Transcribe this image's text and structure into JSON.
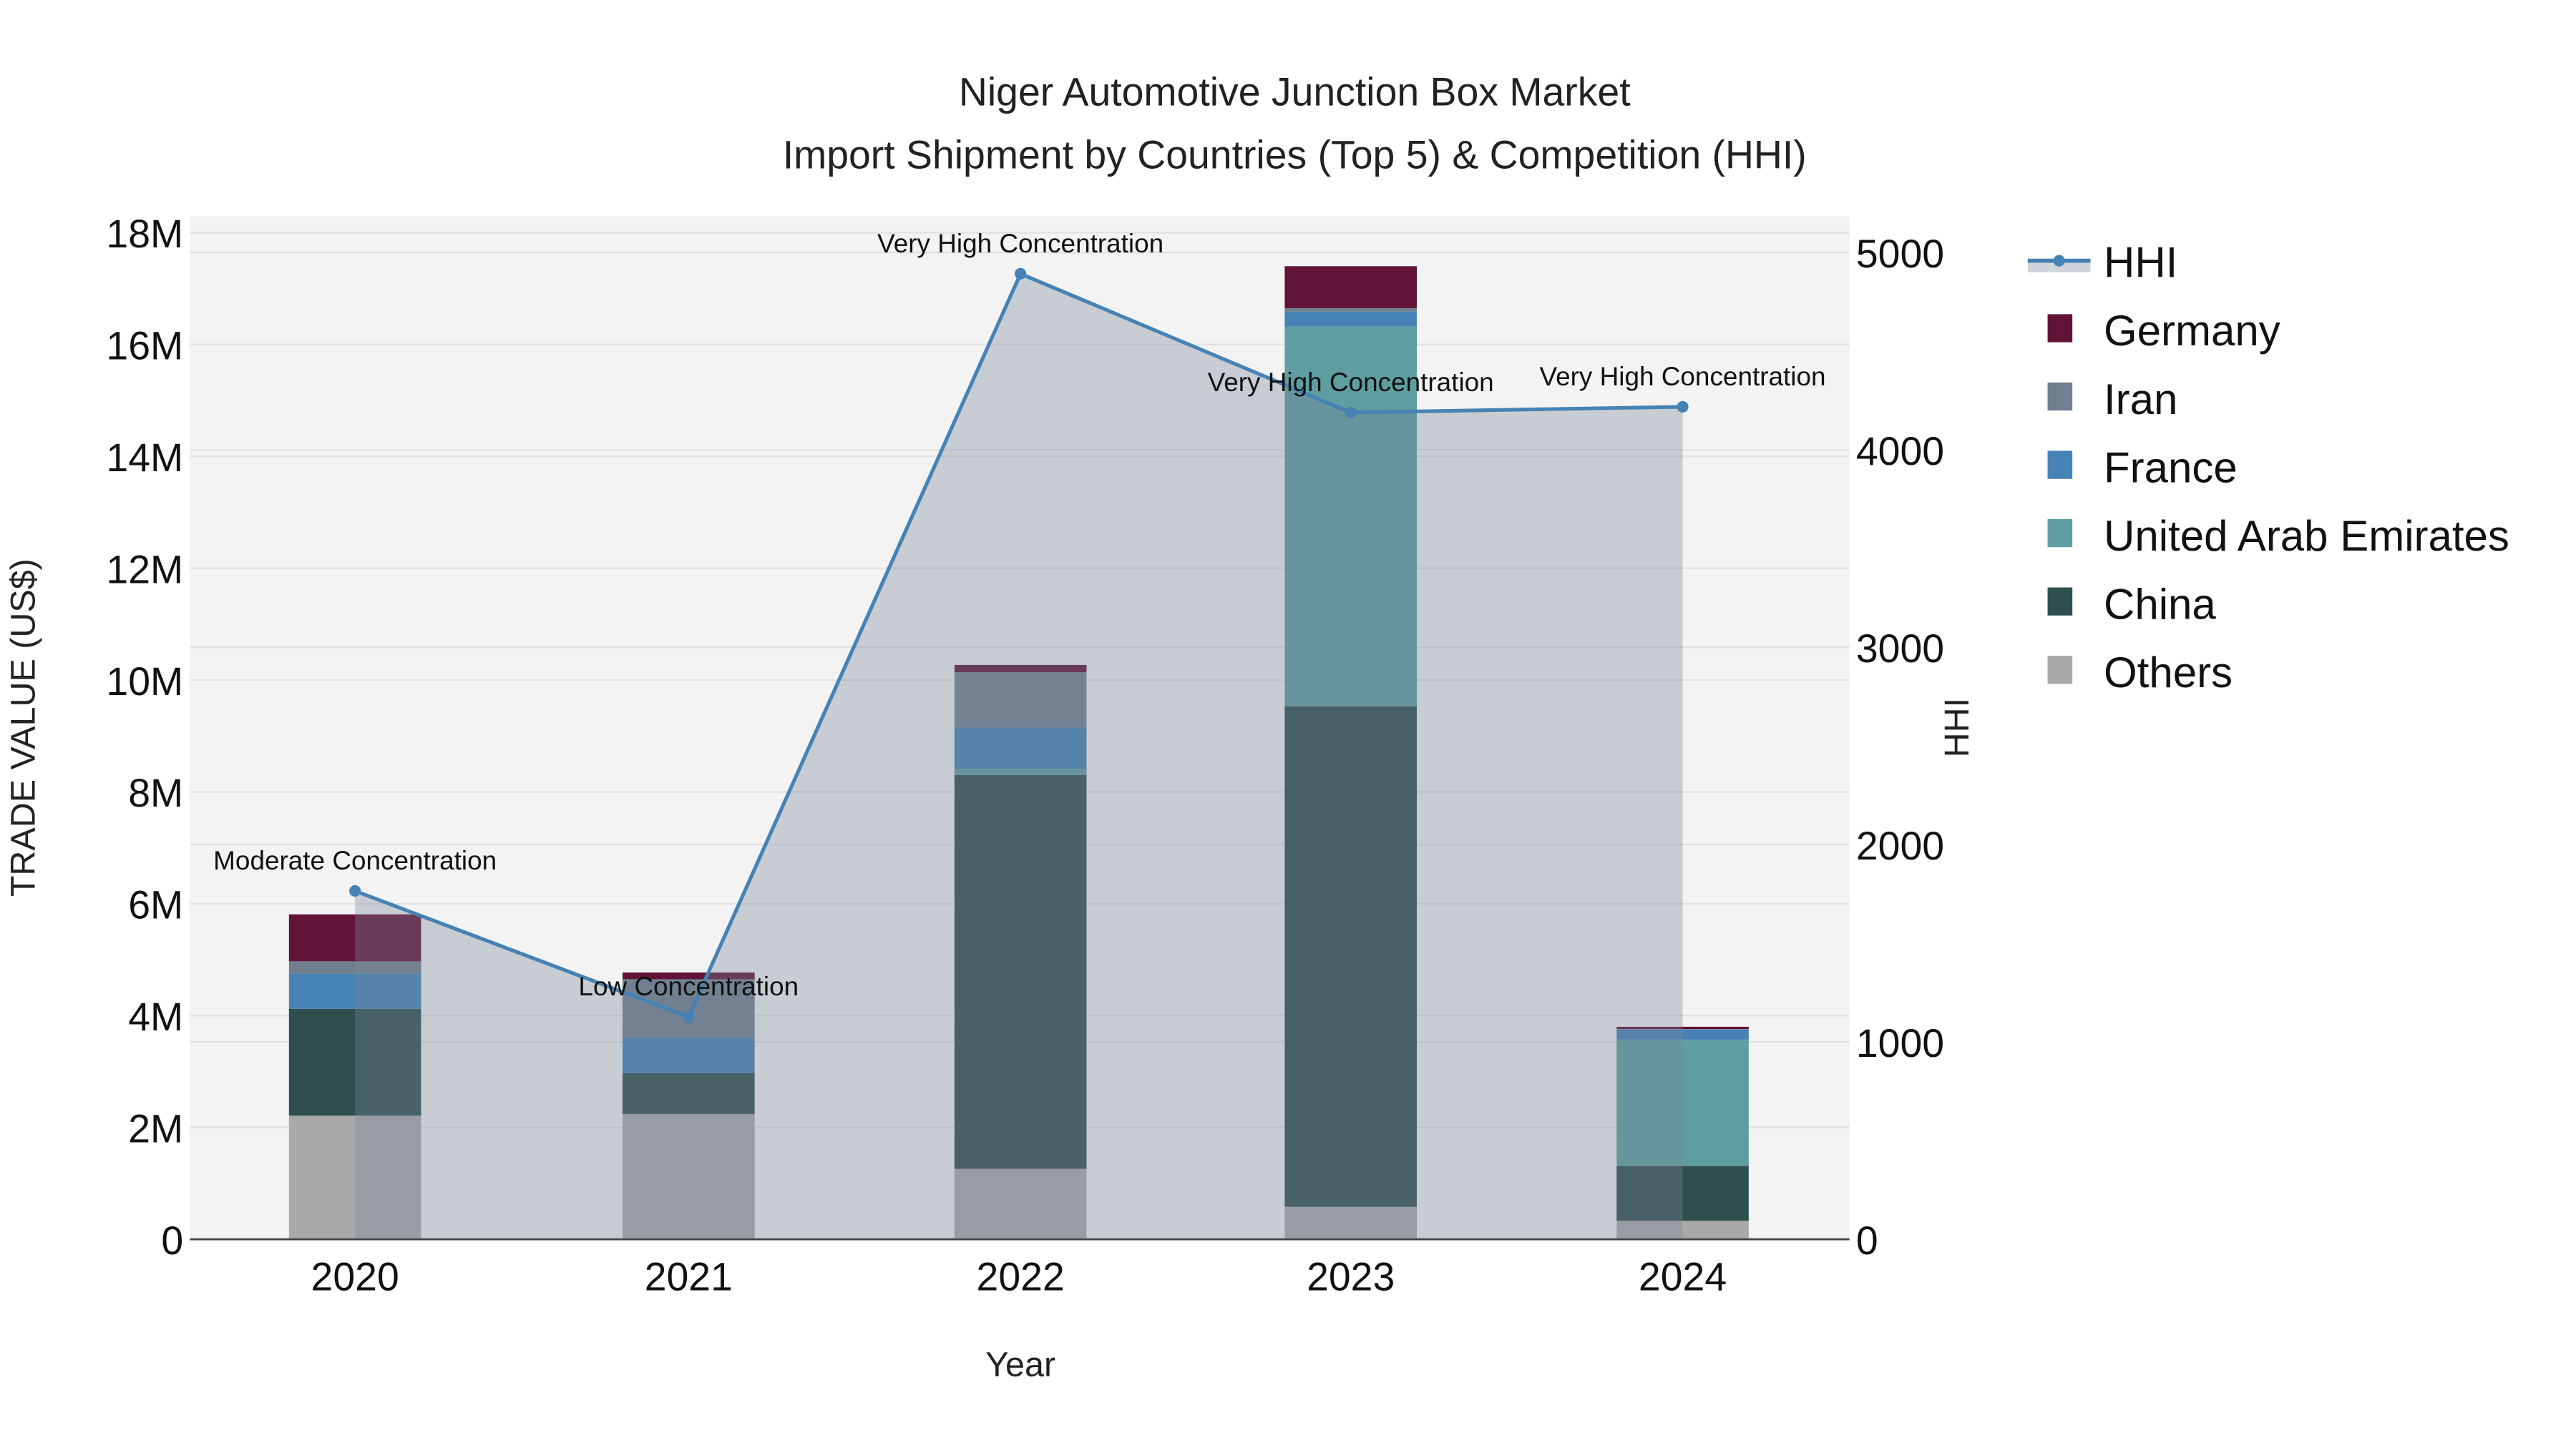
{
  "chart_data": {
    "type": "bar",
    "title": "Niger Automotive Junction Box Market",
    "subtitle": "Import Shipment by Countries (Top 5) & Competition (HHI)",
    "xlabel": "Year",
    "ylabel": "TRADE VALUE (US$)",
    "y2label": "HHI",
    "categories": [
      "2020",
      "2021",
      "2022",
      "2023",
      "2024"
    ],
    "ylim": [
      0,
      18200000
    ],
    "y2lim": [
      0,
      5150
    ],
    "yticks": [
      0,
      2000000,
      4000000,
      6000000,
      8000000,
      10000000,
      12000000,
      14000000,
      16000000,
      18000000
    ],
    "ytick_labels": [
      "0",
      "2M",
      "4M",
      "6M",
      "8M",
      "10M",
      "12M",
      "14M",
      "16M",
      "18M"
    ],
    "y2ticks": [
      0,
      1000,
      2000,
      3000,
      4000,
      5000
    ],
    "y2tick_labels": [
      "0",
      "1000",
      "2000",
      "3000",
      "4000",
      "5000"
    ],
    "stacking": "stacked",
    "series": [
      {
        "name": "Others",
        "color": "#A9A9A9",
        "values": [
          2210000,
          2240000,
          1260000,
          580000,
          330000
        ]
      },
      {
        "name": "China",
        "color": "#2F4F4F",
        "values": [
          1910000,
          730000,
          7040000,
          8950000,
          980000
        ]
      },
      {
        "name": "United Arab Emirates",
        "color": "#5F9EA0",
        "values": [
          0,
          0,
          110000,
          6790000,
          2260000
        ]
      },
      {
        "name": "France",
        "color": "#4682B4",
        "values": [
          630000,
          640000,
          740000,
          270000,
          180000
        ]
      },
      {
        "name": "Iran",
        "color": "#708090",
        "values": [
          220000,
          1040000,
          990000,
          60000,
          10000
        ]
      },
      {
        "name": "Germany",
        "color": "#621436",
        "values": [
          840000,
          120000,
          130000,
          750000,
          40000
        ]
      }
    ],
    "hhi": {
      "name": "HHI",
      "color": "#4682B4",
      "values": [
        1765,
        1127,
        4892,
        4189,
        4218
      ],
      "annotations": [
        "Moderate Concentration",
        "Low Concentration",
        "Very High Concentration",
        "Very High Concentration",
        "Very High Concentration"
      ]
    },
    "legend": {
      "placement": "right",
      "entries": [
        "HHI",
        "Germany",
        "Iran",
        "France",
        "United Arab Emirates",
        "China",
        "Others"
      ]
    },
    "grid": true
  }
}
